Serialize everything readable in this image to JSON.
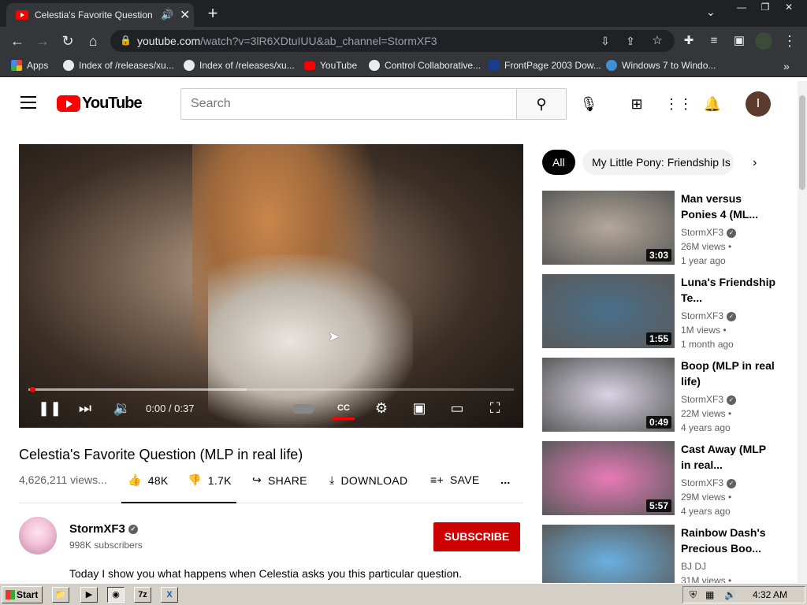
{
  "browser": {
    "tab_title": "Celestia's Favorite Question (M",
    "new_tab": "+",
    "url_host": "youtube.com",
    "url_path": "/watch?v=3lR6XDtuIUU&ab_channel=StormXF3",
    "bookmarks": [
      {
        "label": "Apps",
        "color": "#4285f4"
      },
      {
        "label": "Index of /releases/xu...",
        "color": "#e8eaed"
      },
      {
        "label": "Index of /releases/xu...",
        "color": "#e8eaed"
      },
      {
        "label": "YouTube",
        "color": "#ff0000"
      },
      {
        "label": "Control Collaborative...",
        "color": "#e8eaed"
      },
      {
        "label": "FrontPage 2003 Dow...",
        "color": "#1a3c8c"
      },
      {
        "label": "Windows 7 to Windo...",
        "color": "#3d8fd6"
      }
    ],
    "bookmarks_more": "»"
  },
  "yt": {
    "logo": "YouTube",
    "search_placeholder": "Search",
    "avatar_letter": "I",
    "player": {
      "time": "0:00 / 0:37",
      "progress_loaded_fraction": 0.45,
      "played_fraction": 0.0
    },
    "video_title": "Celestia's Favorite Question (MLP in real life)",
    "views": "4,626,211 views...",
    "likes": "48K",
    "dislikes": "1.7K",
    "share": "SHARE",
    "download": "DOWNLOAD",
    "save": "SAVE",
    "more": "...",
    "channel": {
      "name": "StormXF3",
      "subs": "998K subscribers",
      "subscribe": "SUBSCRIBE"
    },
    "description": "Today I show you what happens when Celestia asks you this particular question.",
    "chips": [
      "All",
      "My Little Pony: Friendship Is"
    ],
    "recs": [
      {
        "title": "Man versus Ponies 4 (ML...",
        "channel": "StormXF3",
        "views": "26M views •",
        "age": "1 year ago",
        "duration": "3:03",
        "thumb_color": "#b5a89a"
      },
      {
        "title": "Luna's Friendship Te...",
        "channel": "StormXF3",
        "views": "1M views •",
        "age": "1 month ago",
        "duration": "1:55",
        "thumb_color": "#4a6f8a"
      },
      {
        "title": "Boop (MLP in real life)",
        "channel": "StormXF3",
        "views": "22M views •",
        "age": "4 years ago",
        "duration": "0:49",
        "thumb_color": "#d8d4e4"
      },
      {
        "title": "Cast Away (MLP in real...",
        "channel": "StormXF3",
        "views": "29M views •",
        "age": "4 years ago",
        "duration": "5:57",
        "thumb_color": "#e87ab8"
      },
      {
        "title": "Rainbow Dash's Precious Boo...",
        "channel": "BJ DJ",
        "views": "31M views •",
        "age": "",
        "duration": "",
        "thumb_color": "#6ab0e0"
      }
    ]
  },
  "taskbar": {
    "start": "Start",
    "clock": "4:32 AM"
  }
}
